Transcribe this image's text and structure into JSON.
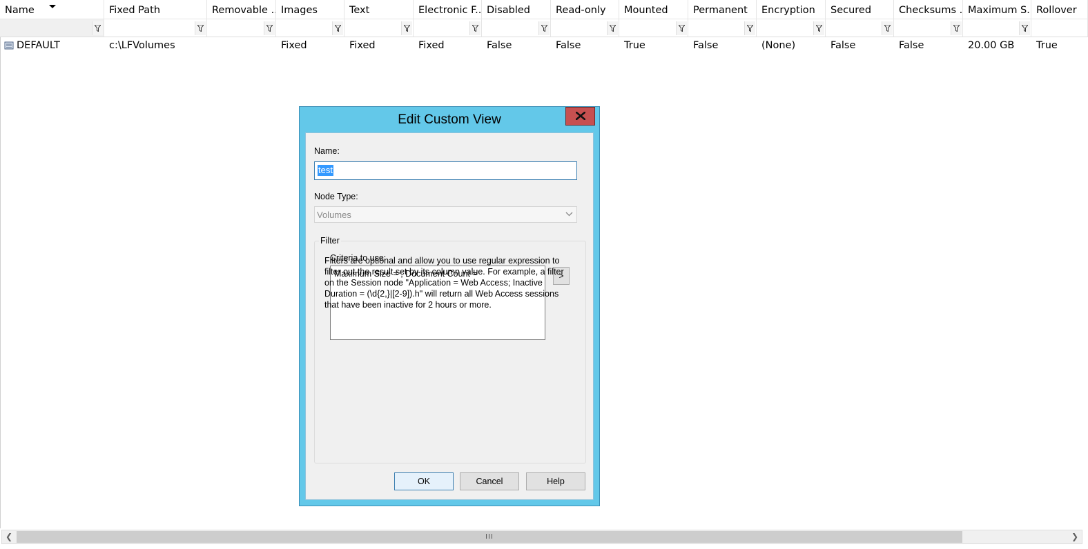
{
  "grid": {
    "columns": [
      {
        "label": "Name"
      },
      {
        "label": "Fixed Path"
      },
      {
        "label": "Removable ..."
      },
      {
        "label": "Images"
      },
      {
        "label": "Text"
      },
      {
        "label": "Electronic F..."
      },
      {
        "label": "Disabled"
      },
      {
        "label": "Read-only"
      },
      {
        "label": "Mounted"
      },
      {
        "label": "Permanent"
      },
      {
        "label": "Encryption"
      },
      {
        "label": "Secured"
      },
      {
        "label": "Checksums ..."
      },
      {
        "label": "Maximum S..."
      },
      {
        "label": "Rollover"
      }
    ],
    "rows": [
      {
        "icon": "volume-icon",
        "cells": [
          "DEFAULT",
          "c:\\LFVolumes",
          "",
          "Fixed",
          "Fixed",
          "Fixed",
          "False",
          "False",
          "True",
          "False",
          "(None)",
          "False",
          "False",
          "20.00 GB",
          "True"
        ]
      }
    ]
  },
  "scrollbar": {
    "thumb_grip": "III"
  },
  "dialog": {
    "title": "Edit Custom View",
    "name_label": "Name:",
    "name_value": "test",
    "node_type_label": "Node Type:",
    "node_type_value": "Volumes",
    "filter_group_label": "Filter",
    "criteria_label": "Criteria to use:",
    "criteria_value": "Maximum Size = ; Document Count =",
    "arrow_button": ">",
    "help_text": "Filters are optional and allow you to use regular expression to filter out the result set by its column value. For example, a filter on the Session node \"Application = Web Access; Inactive Duration = (\\d{2,}|[2-9]).h\" will return all Web Access sessions that have been inactive for 2 hours or more.",
    "ok_label": "OK",
    "cancel_label": "Cancel",
    "help_label": "Help"
  },
  "colors": {
    "dialog_frame": "#63c8e9",
    "close_button": "#c75050",
    "selection": "#3399ff"
  }
}
